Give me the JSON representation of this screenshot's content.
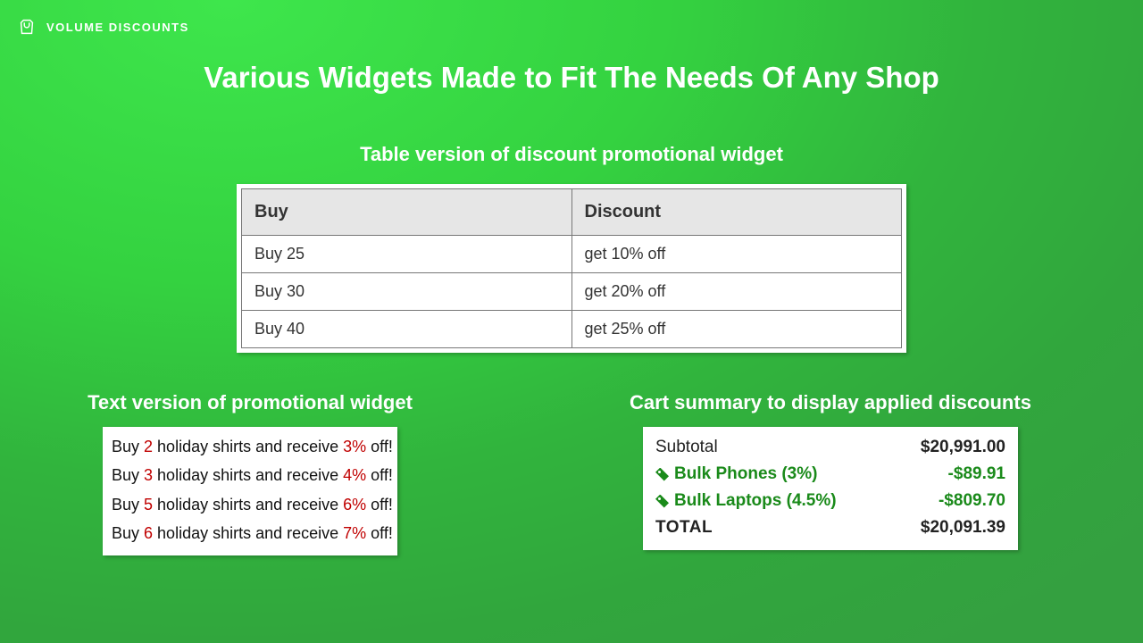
{
  "brand": {
    "label": "VOLUME DISCOUNTS"
  },
  "page_title": "Various Widgets Made to Fit The Needs Of Any Shop",
  "table_widget": {
    "heading": "Table version of discount promotional widget",
    "col_buy": "Buy",
    "col_discount": "Discount",
    "rows": [
      {
        "buy": "Buy 25",
        "discount": "get 10% off"
      },
      {
        "buy": "Buy 30",
        "discount": "get 20% off"
      },
      {
        "buy": "Buy 40",
        "discount": "get 25% off"
      }
    ]
  },
  "text_widget": {
    "heading": "Text version of promotional widget",
    "lines": [
      {
        "p0": "Buy ",
        "qty": "2",
        "p1": " holiday shirts and receive ",
        "pct": "3%",
        "p2": " off!"
      },
      {
        "p0": "Buy ",
        "qty": "3",
        "p1": " holiday shirts and receive ",
        "pct": "4%",
        "p2": " off!"
      },
      {
        "p0": "Buy ",
        "qty": "5",
        "p1": " holiday shirts and receive ",
        "pct": "6%",
        "p2": " off!"
      },
      {
        "p0": "Buy ",
        "qty": "6",
        "p1": " holiday shirts and receive ",
        "pct": "7%",
        "p2": " off!"
      }
    ]
  },
  "cart_widget": {
    "heading": "Cart summary to display applied discounts",
    "subtotal_label": "Subtotal",
    "subtotal_amount": "$20,991.00",
    "discounts": [
      {
        "label": "Bulk Phones (3%)",
        "amount": "-$89.91"
      },
      {
        "label": "Bulk Laptops (4.5%)",
        "amount": "-$809.70"
      }
    ],
    "total_label": "TOTAL",
    "total_amount": "$20,091.39"
  }
}
